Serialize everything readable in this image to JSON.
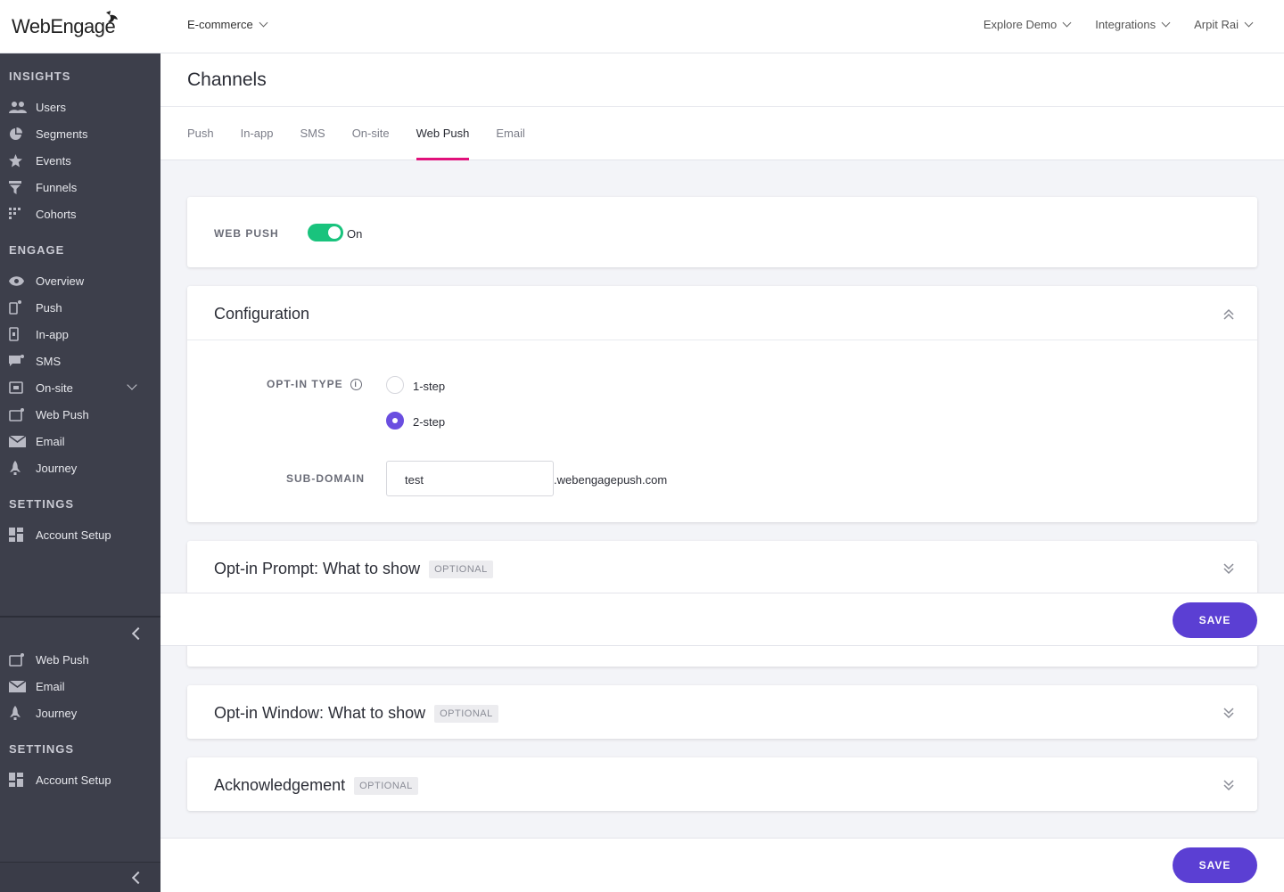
{
  "header": {
    "logo_text": "WebEngage",
    "project": "E-commerce",
    "nav": [
      "Explore Demo",
      "Integrations",
      "Arpit Rai"
    ]
  },
  "sidebar": {
    "insights_heading": "INSIGHTS",
    "insights": [
      {
        "label": "Users",
        "icon": "users-icon"
      },
      {
        "label": "Segments",
        "icon": "pie-icon"
      },
      {
        "label": "Events",
        "icon": "star-icon"
      },
      {
        "label": "Funnels",
        "icon": "funnel-icon"
      },
      {
        "label": "Cohorts",
        "icon": "grid-icon"
      }
    ],
    "engage_heading": "ENGAGE",
    "engage": [
      {
        "label": "Overview",
        "icon": "eye-icon"
      },
      {
        "label": "Push",
        "icon": "mobile-icon"
      },
      {
        "label": "In-app",
        "icon": "inapp-icon"
      },
      {
        "label": "SMS",
        "icon": "chat-icon"
      },
      {
        "label": "On-site",
        "icon": "window-icon"
      },
      {
        "label": "Web Push",
        "icon": "browser-icon"
      },
      {
        "label": "Email",
        "icon": "mail-icon"
      },
      {
        "label": "Journey",
        "icon": "rocket-icon"
      }
    ],
    "settings_heading": "SETTINGS",
    "settings": [
      {
        "label": "Account Setup",
        "icon": "dashboard-icon"
      }
    ],
    "lower": {
      "items": [
        {
          "label": "Web Push",
          "icon": "browser-icon"
        },
        {
          "label": "Email",
          "icon": "mail-icon"
        },
        {
          "label": "Journey",
          "icon": "rocket-icon"
        }
      ],
      "settings_heading": "SETTINGS",
      "settings_item": "Account Setup"
    }
  },
  "page": {
    "title": "Channels",
    "tabs": [
      "Push",
      "In-app",
      "SMS",
      "On-site",
      "Web Push",
      "Email"
    ],
    "active_tab": "Web Push"
  },
  "webpush": {
    "label": "WEB PUSH",
    "toggle_state": "On",
    "toggle_on": true
  },
  "configuration": {
    "title": "Configuration",
    "optin_label": "OPT-IN TYPE",
    "options": [
      "1-step",
      "2-step"
    ],
    "selected": "2-step",
    "subdomain_label": "SUB-DOMAIN",
    "subdomain_value": "test",
    "subdomain_suffix": ".webengagepush.com"
  },
  "sections": [
    {
      "title": "Opt-in Prompt: What to show",
      "badge": "OPTIONAL"
    },
    {
      "title": "Opt-in Window: What to show",
      "badge": "OPTIONAL"
    },
    {
      "title": "Acknowledgement",
      "badge": "OPTIONAL"
    }
  ],
  "actions": {
    "save": "SAVE"
  },
  "colors": {
    "accent_tab": "#e1117b",
    "toggle": "#19c37d",
    "primary_button": "#5b3fd3",
    "radio_selected": "#6a4ee0",
    "sidebar_bg": "#3d3f4b"
  }
}
